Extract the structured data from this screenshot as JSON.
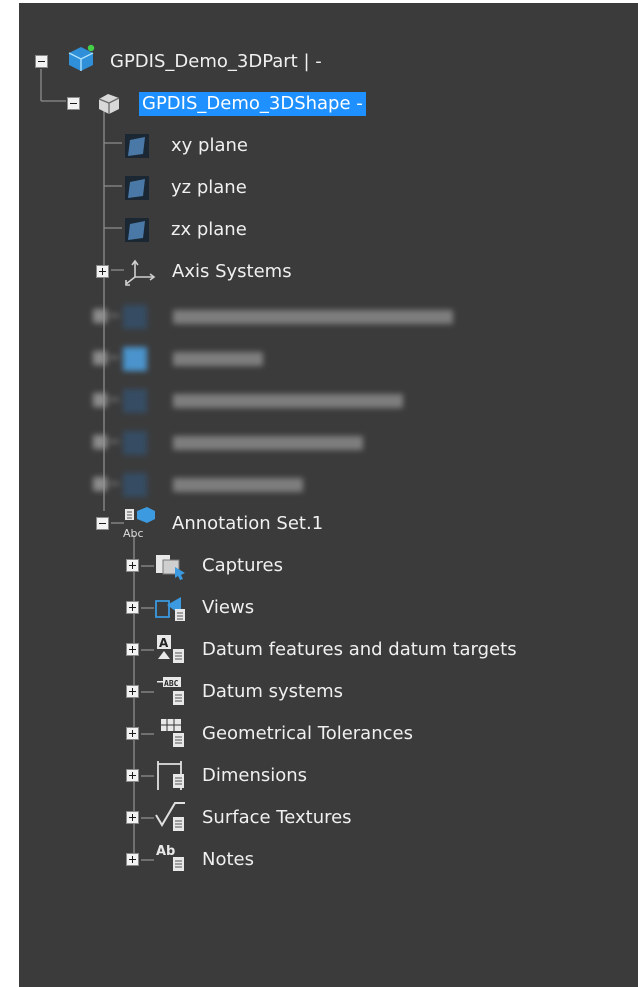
{
  "tree": {
    "root": {
      "label": "GPDIS_Demo_3DPart | -",
      "icon": "3dpart-icon",
      "expander": "minus"
    },
    "shape": {
      "label": "GPDIS_Demo_3DShape -",
      "icon": "3dshape-icon",
      "expander": "minus",
      "selected": true
    },
    "planes": [
      {
        "label": "xy plane",
        "icon": "plane-icon"
      },
      {
        "label": "yz plane",
        "icon": "plane-icon"
      },
      {
        "label": "zx plane",
        "icon": "plane-icon"
      }
    ],
    "axis_systems": {
      "label": "Axis Systems",
      "icon": "axis-systems-icon",
      "expander": "plus"
    },
    "redacted_items_count": 5,
    "annotation_set": {
      "label": "Annotation Set.1",
      "icon": "annotation-set-icon",
      "expander": "minus"
    },
    "annotation_children": [
      {
        "label": "Captures",
        "icon": "captures-icon"
      },
      {
        "label": "Views",
        "icon": "views-icon"
      },
      {
        "label": "Datum features and datum targets",
        "icon": "datum-features-icon"
      },
      {
        "label": "Datum systems",
        "icon": "datum-systems-icon"
      },
      {
        "label": "Geometrical Tolerances",
        "icon": "geometrical-tolerances-icon"
      },
      {
        "label": "Dimensions",
        "icon": "dimensions-icon"
      },
      {
        "label": "Surface Textures",
        "icon": "surface-textures-icon"
      },
      {
        "label": "Notes",
        "icon": "notes-icon"
      }
    ]
  },
  "colors": {
    "panel_bg": "#3b3b3b",
    "selection": "#1e90ff",
    "text": "#f0f0f0",
    "line": "#8c8c8c"
  }
}
